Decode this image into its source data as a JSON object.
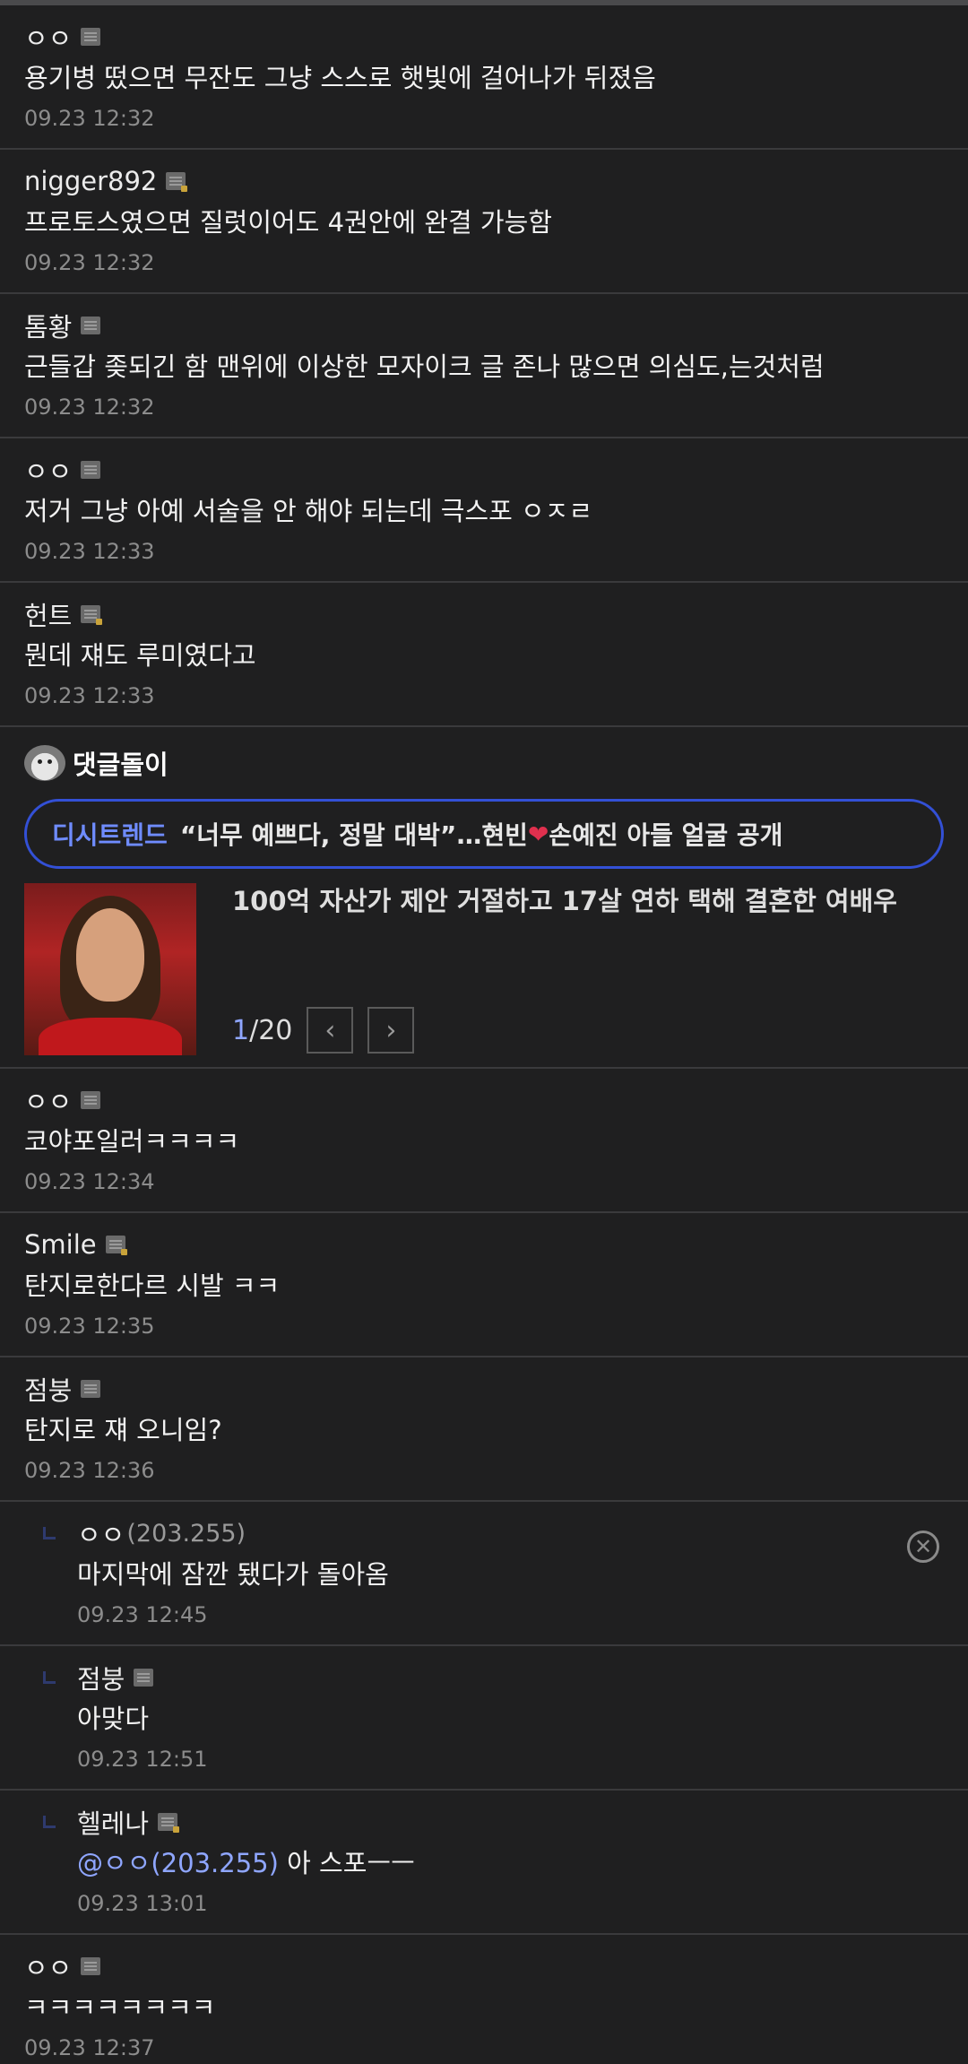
{
  "comments_top": [
    {
      "name": "ㅇㅇ",
      "badge": "plain",
      "text": "용기병 떴으면 무잔도 그냥 스스로 햇빛에 걸어나가 뒤졌음",
      "date": "09.23 12:32"
    },
    {
      "name": "nigger892",
      "badge": "gold",
      "text": "프로토스였으면 질럿이어도 4권안에 완결 가능함",
      "date": "09.23 12:32"
    },
    {
      "name": "톰황",
      "badge": "plain",
      "text": "근들갑 좆되긴 함 맨위에 이상한 모자이크 글 존나 많으면 의심도,는것처럼",
      "date": "09.23 12:32"
    },
    {
      "name": "ㅇㅇ",
      "badge": "plain",
      "text": "저거 그냥 아예 서술을 안 해야 되는데 극스포 ㅇㅈㄹ",
      "date": "09.23 12:33"
    },
    {
      "name": "헌트",
      "badge": "gold",
      "text": "뭔데 쟤도 루미였다고",
      "date": "09.23 12:33"
    }
  ],
  "ad": {
    "title": "댓글돌이",
    "brand": "디시트렌드",
    "headline_a": "“너무 예쁘다, 정말 대박”…현빈",
    "heart": "❤",
    "headline_b": "손예진 아들 얼굴 공개",
    "article": "100억 자산가 제안 거절하고 17살 연하 택해 결혼한 여배우",
    "page_current": "1",
    "page_total": "/20",
    "prev_glyph": "‹",
    "next_glyph": "›"
  },
  "comments_mid": [
    {
      "name": "ㅇㅇ",
      "badge": "plain",
      "text": "코야포일러ㅋㅋㅋㅋ",
      "date": "09.23 12:34"
    },
    {
      "name": "Smile",
      "badge": "gold",
      "text": "탄지로한다르 시발 ㅋㅋ",
      "date": "09.23 12:35"
    },
    {
      "name": "점붕",
      "badge": "plain",
      "text": "탄지로 쟤 오니임?",
      "date": "09.23 12:36"
    }
  ],
  "replies": [
    {
      "name": "ㅇㅇ",
      "ip": "(203.255)",
      "text": "마지막에 잠깐 됐다가 돌아옴",
      "date": "09.23 12:45",
      "close": "✕"
    },
    {
      "name": "점붕",
      "badge": "plain",
      "text": "아맞다",
      "date": "09.23 12:51"
    },
    {
      "name": "헬레나",
      "badge": "gold",
      "mention": "@ㅇㅇ(203.255)",
      "text": " 아 스포ㅡㅡ",
      "date": "09.23 13:01"
    }
  ],
  "comments_bottom": [
    {
      "name": "ㅇㅇ",
      "badge": "plain",
      "text": "ㅋㅋㅋㅋㅋㅋㅋㅋ",
      "date": "09.23 12:37"
    }
  ]
}
